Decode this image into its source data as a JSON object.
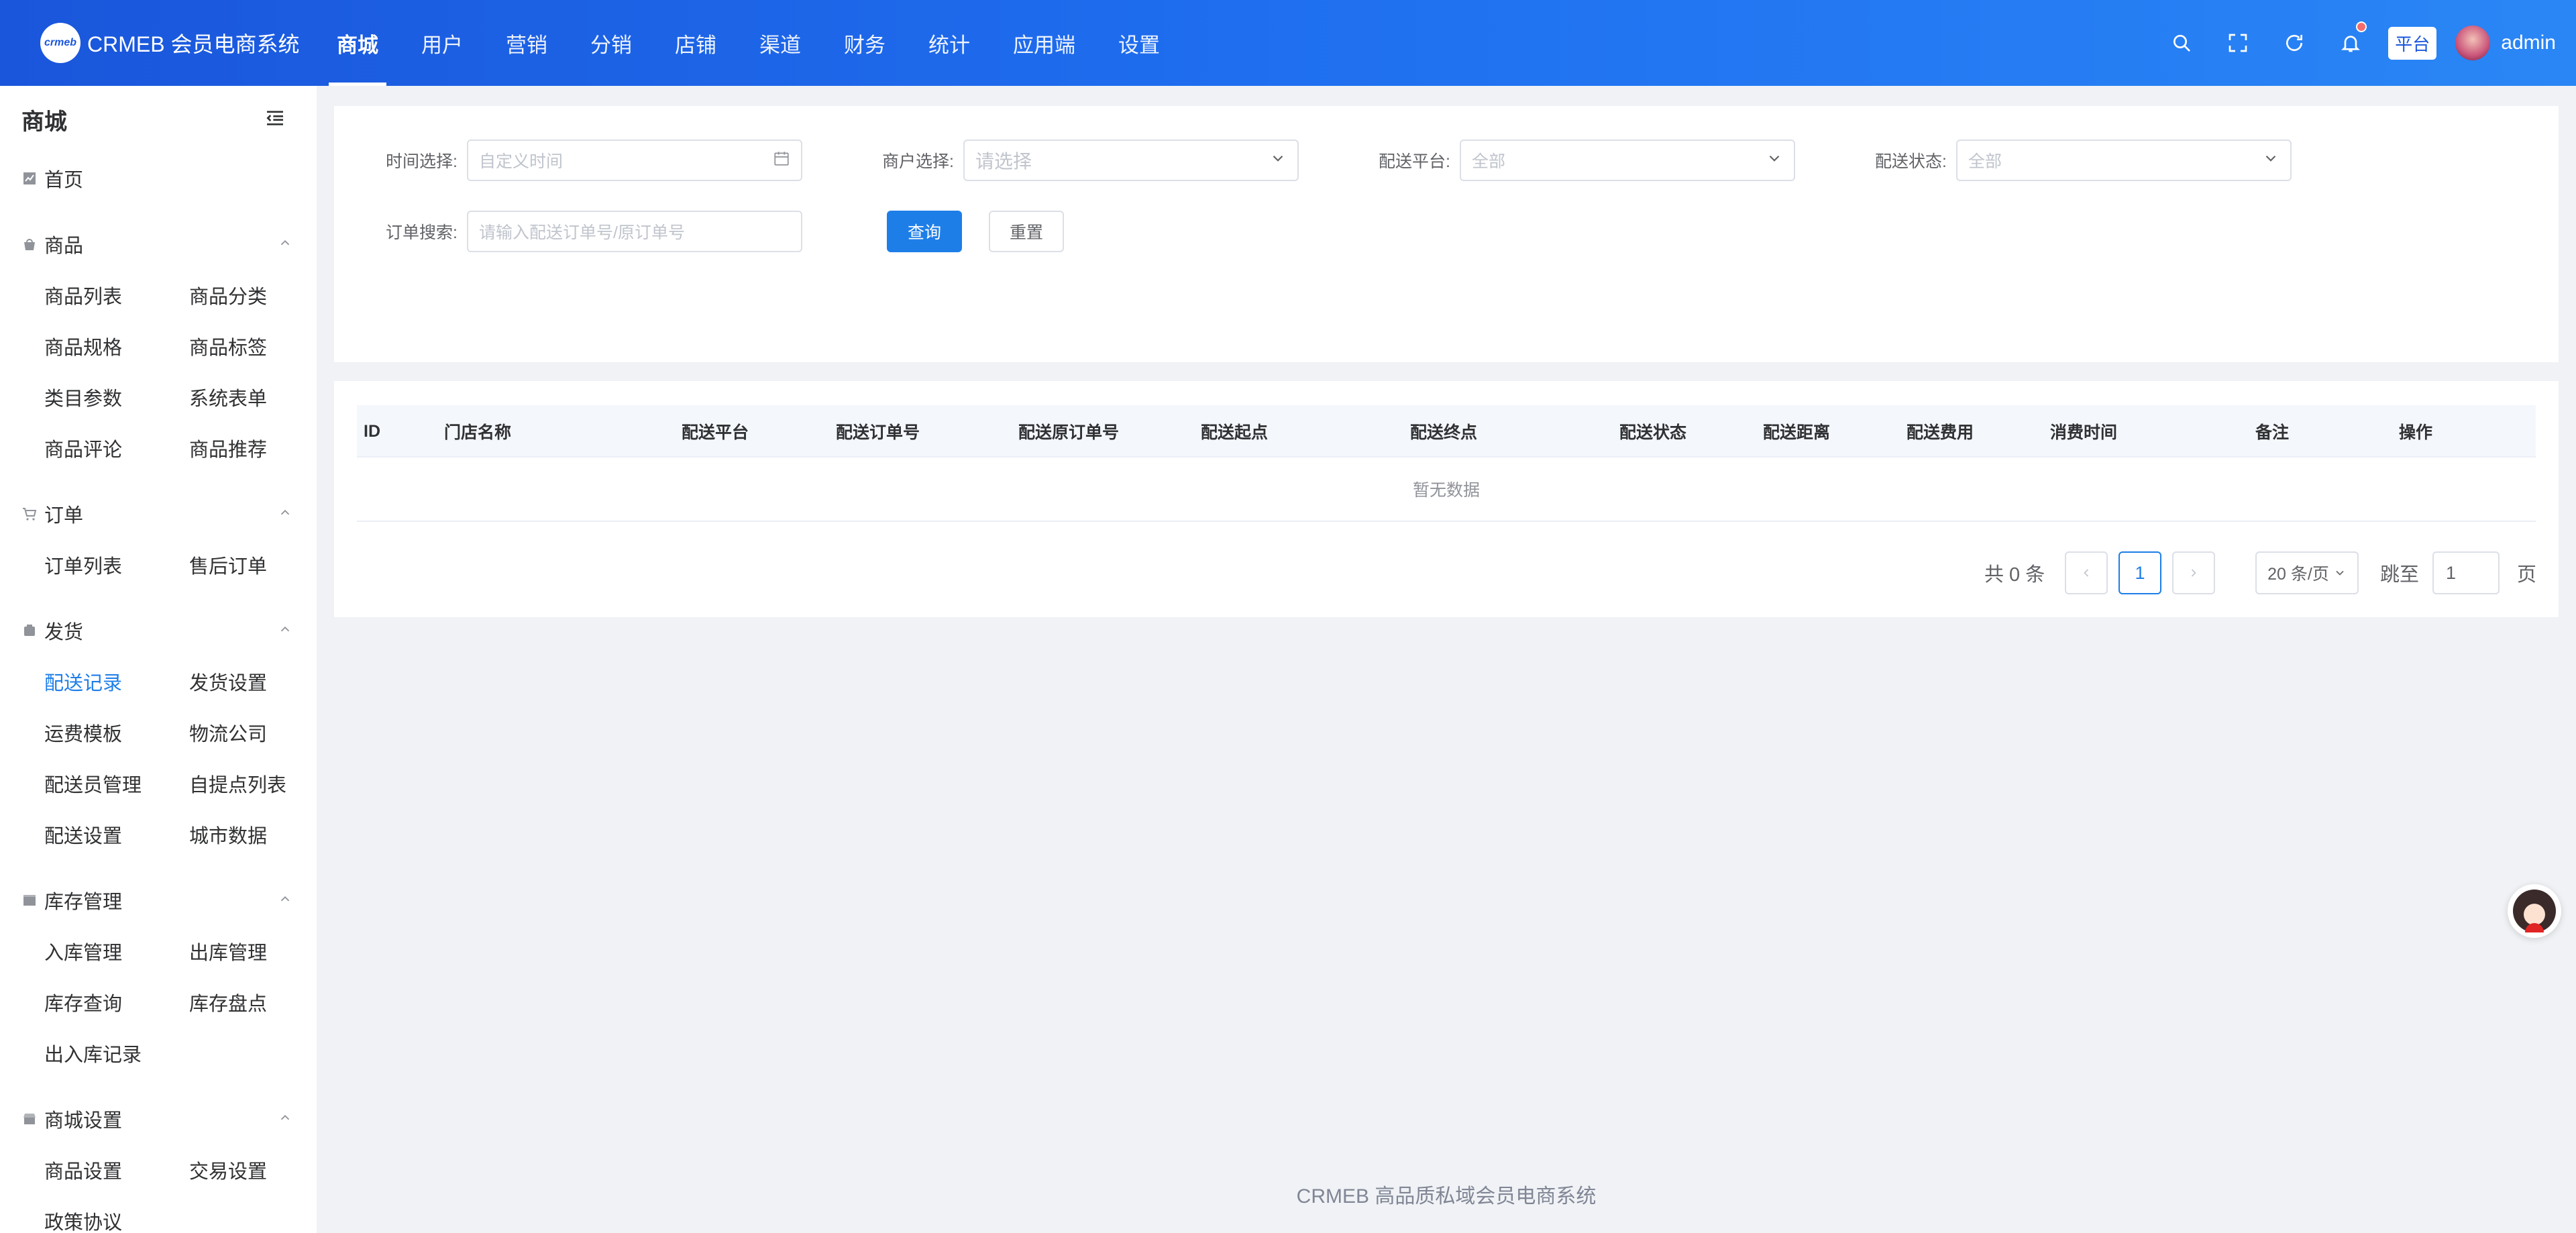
{
  "app": {
    "logo_text": "crmeb",
    "title": "CRMEB 会员电商系统"
  },
  "topnav": [
    {
      "label": "商城",
      "active": true
    },
    {
      "label": "用户"
    },
    {
      "label": "营销"
    },
    {
      "label": "分销"
    },
    {
      "label": "店铺"
    },
    {
      "label": "渠道"
    },
    {
      "label": "财务"
    },
    {
      "label": "统计"
    },
    {
      "label": "应用端"
    },
    {
      "label": "设置"
    }
  ],
  "topright": {
    "icons": [
      "search-icon",
      "fullscreen-icon",
      "refresh-icon",
      "bell-icon"
    ],
    "platform_badge": "平台",
    "username": "admin"
  },
  "sidebar": {
    "title": "商城",
    "home": "首页",
    "groups": [
      {
        "title": "商品",
        "icon": "goods-icon",
        "items": [
          "商品列表",
          "商品分类",
          "商品规格",
          "商品标签",
          "类目参数",
          "系统表单",
          "商品评论",
          "商品推荐"
        ]
      },
      {
        "title": "订单",
        "icon": "cart-icon",
        "items": [
          "订单列表",
          "售后订单"
        ]
      },
      {
        "title": "发货",
        "icon": "delivery-icon",
        "items": [
          "配送记录",
          "发货设置",
          "运费模板",
          "物流公司",
          "配送员管理",
          "自提点列表",
          "配送设置",
          "城市数据"
        ]
      },
      {
        "title": "库存管理",
        "icon": "inventory-icon",
        "items": [
          "入库管理",
          "出库管理",
          "库存查询",
          "库存盘点",
          "出入库记录"
        ]
      },
      {
        "title": "商城设置",
        "icon": "store-icon",
        "items": [
          "商品设置",
          "交易设置",
          "政策协议"
        ]
      }
    ],
    "active_item": "配送记录"
  },
  "filters": {
    "time_label": "时间选择:",
    "time_placeholder": "自定义时间",
    "merchant_label": "商户选择:",
    "merchant_placeholder": "请选择",
    "platform_label": "配送平台:",
    "platform_value": "全部",
    "status_label": "配送状态:",
    "status_value": "全部",
    "search_label": "订单搜索:",
    "search_placeholder": "请输入配送订单号/原订单号",
    "query_button": "查询",
    "reset_button": "重置"
  },
  "table": {
    "columns": [
      "ID",
      "门店名称",
      "配送平台",
      "配送订单号",
      "配送原订单号",
      "配送起点",
      "配送终点",
      "配送状态",
      "配送距离",
      "配送费用",
      "消费时间",
      "备注",
      "操作"
    ],
    "empty_text": "暂无数据"
  },
  "pagination": {
    "total_text": "共 0 条",
    "current_page": "1",
    "page_size": "20 条/页",
    "jump_label": "跳至",
    "jump_value": "1",
    "page_unit": "页"
  },
  "footer": "CRMEB 高品质私域会员电商系统"
}
